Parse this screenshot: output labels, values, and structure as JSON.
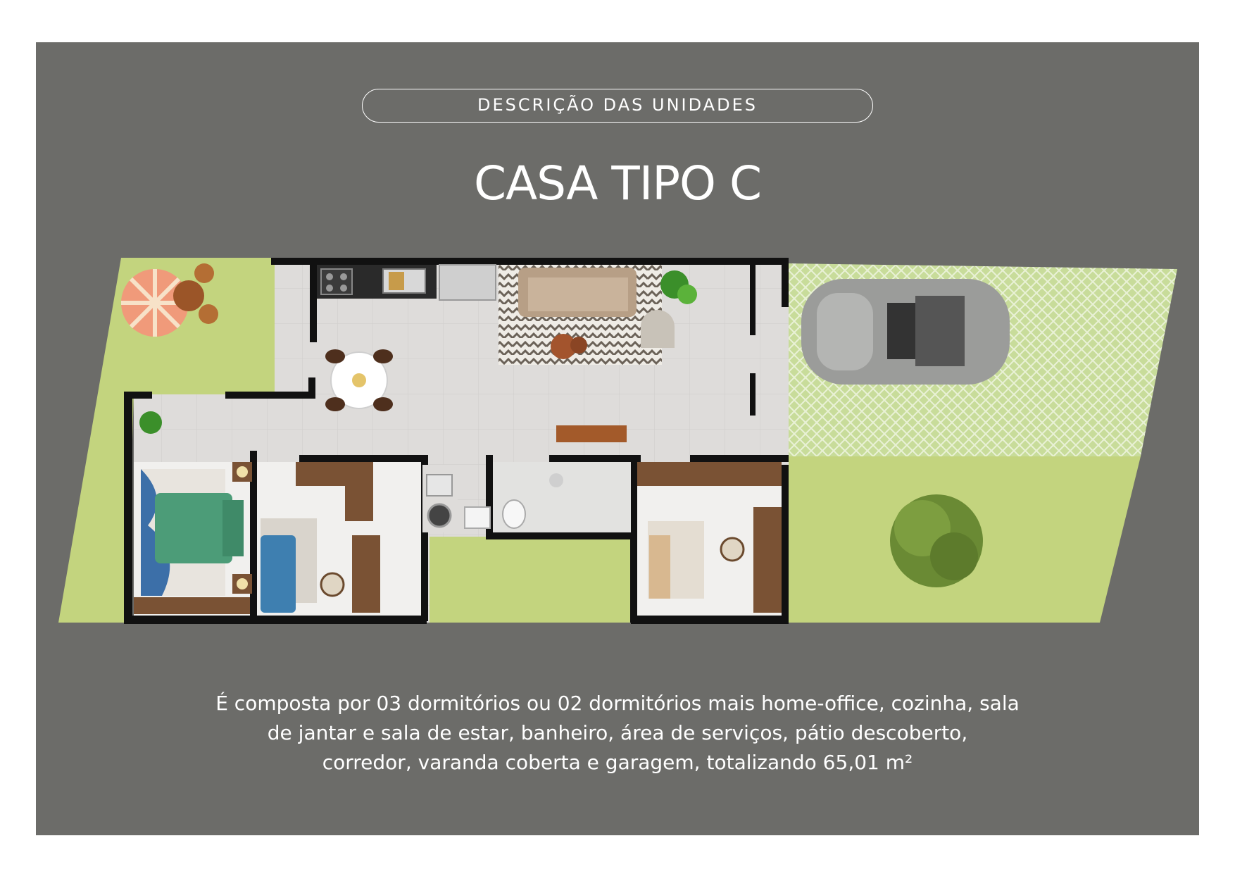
{
  "header": {
    "section_label": "DESCRIÇÃO DAS UNIDADES",
    "title": "CASA TIPO C"
  },
  "description": {
    "line1": "É composta por 03 dormitórios ou 02 dormitórios mais home-office, cozinha, sala",
    "line2": "de jantar e sala de estar, banheiro, área de serviços, pátio descoberto,",
    "line3": "corredor, varanda coberta e garagem, totalizando 65,01 m²"
  },
  "colors": {
    "panel": "#6c6c69",
    "lawn": "#c3d47e",
    "floor": "#dcdad8",
    "wall": "#111111",
    "wood": "#7a5234"
  }
}
